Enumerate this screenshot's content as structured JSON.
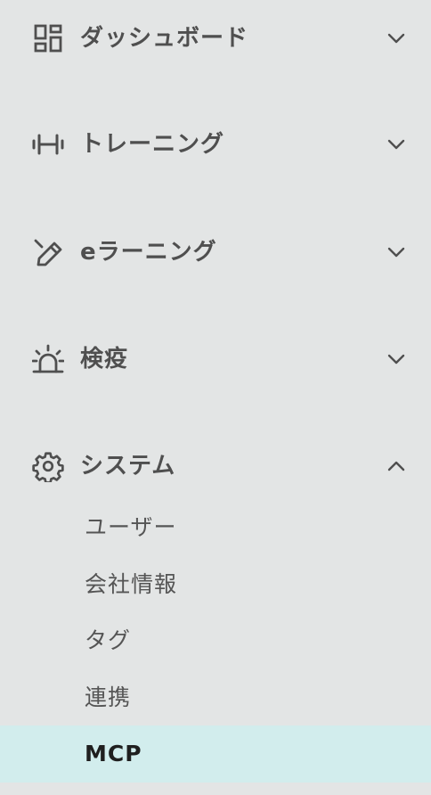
{
  "sidebar": {
    "groups": [
      {
        "label": "ダッシュボード",
        "icon": "dashboard-grid-icon",
        "expanded": false
      },
      {
        "label": "トレーニング",
        "icon": "dumbbell-icon",
        "expanded": false
      },
      {
        "label": "eラーニング",
        "icon": "pencil-icon",
        "expanded": false
      },
      {
        "label": "検疫",
        "icon": "alarm-light-icon",
        "expanded": false
      },
      {
        "label": "システム",
        "icon": "gear-icon",
        "expanded": true
      }
    ],
    "system_items": [
      {
        "label": "ユーザー",
        "active": false
      },
      {
        "label": "会社情報",
        "active": false
      },
      {
        "label": "タグ",
        "active": false
      },
      {
        "label": "連携",
        "active": false
      },
      {
        "label": "MCP",
        "active": true
      }
    ]
  },
  "colors": {
    "background": "#e3e5e5",
    "active_background": "#d2eded",
    "text": "#4f4f4f",
    "active_text": "#1f1f1f"
  }
}
